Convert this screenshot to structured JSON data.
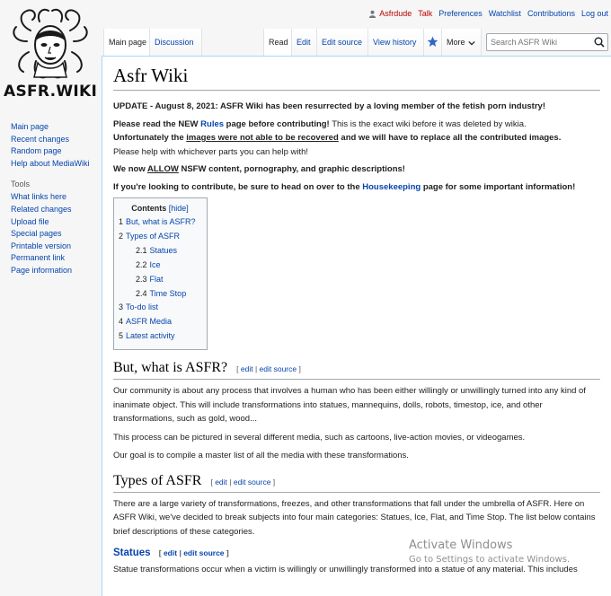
{
  "logo": {
    "text": "ASFR.WIKI"
  },
  "sidebar": {
    "nav": [
      "Main page",
      "Recent changes",
      "Random page",
      "Help about MediaWiki"
    ],
    "tools_heading": "Tools",
    "tools": [
      "What links here",
      "Related changes",
      "Upload file",
      "Special pages",
      "Printable version",
      "Permanent link",
      "Page information"
    ]
  },
  "personal": {
    "username": "Asfrdude",
    "items": [
      "Talk",
      "Preferences",
      "Watchlist",
      "Contributions",
      "Log out"
    ]
  },
  "tabs": {
    "main_page": "Main page",
    "discussion": "Discussion",
    "read": "Read",
    "edit": "Edit",
    "edit_source": "Edit source",
    "view_history": "View history",
    "more": "More"
  },
  "search": {
    "placeholder": "Search ASFR Wiki"
  },
  "content": {
    "title": "Asfr Wiki",
    "update": "UPDATE - August 8, 2021: ASFR Wiki has been resurrected by a loving member of the fetish porn industry!",
    "rules_pre": "Please read the NEW ",
    "rules_link": "Rules",
    "rules_mid": " page before contributing!",
    "rules_post": " This is the exact wiki before it was deleted by wikia.",
    "images_pre": "Unfortunately the ",
    "images_link": "images were not able to be recovered",
    "images_post": " and we will have to replace all the contributed images.",
    "help_line": "Please help with whichever parts you can help with!",
    "nsfw_pre": "We now ",
    "nsfw_allow": "ALLOW",
    "nsfw_post": " NSFW content, pornography, and graphic descriptions!",
    "contrib_pre": "If you're looking to contribute, be sure to head on over to the ",
    "contrib_link": "Housekeeping",
    "contrib_post": " page for some important information!"
  },
  "toc": {
    "title": "Contents",
    "hide": "[hide]",
    "items": [
      {
        "num": "1",
        "label": "But, what is ASFR?"
      },
      {
        "num": "2",
        "label": "Types of ASFR"
      },
      {
        "num": "2.1",
        "label": "Statues"
      },
      {
        "num": "2.2",
        "label": "Ice"
      },
      {
        "num": "2.3",
        "label": "Flat"
      },
      {
        "num": "2.4",
        "label": "Time Stop"
      },
      {
        "num": "3",
        "label": "To-do list"
      },
      {
        "num": "4",
        "label": "ASFR Media"
      },
      {
        "num": "5",
        "label": "Latest activity"
      }
    ]
  },
  "sections": {
    "edit_open": "[ ",
    "edit": "edit",
    "sep": " | ",
    "edit_source": "edit source",
    "edit_close": " ]",
    "s1": {
      "title": "But, what is ASFR?",
      "p1": "Our community is about any process that involves a human who has been either willingly or unwillingly turned into any kind of inanimate object. This will include transformations into statues, mannequins, dolls, robots, timestop, ice, and other transformations, such as gold, wood...",
      "p2": "This process can be pictured in several different media, such as cartoons, live-action movies, or videogames.",
      "p3": "Our goal is to compile a master list of all the media with these transformations."
    },
    "s2": {
      "title": "Types of ASFR",
      "p1": "There are a large variety of transformations, freezes, and other transformations that fall under the umbrella of ASFR. Here on ASFR Wiki, we've decided to break subjects into four main categories: Statues, Ice, Flat, and Time Stop. The list below contains brief descriptions of these categories."
    },
    "s3": {
      "title": "Statues",
      "p1": "Statue transformations occur when a victim is willingly or unwillingly transformed into a statue of any material. This includes"
    }
  },
  "watermark": {
    "line1": "Activate Windows",
    "line2": "Go to Settings to activate Windows."
  }
}
